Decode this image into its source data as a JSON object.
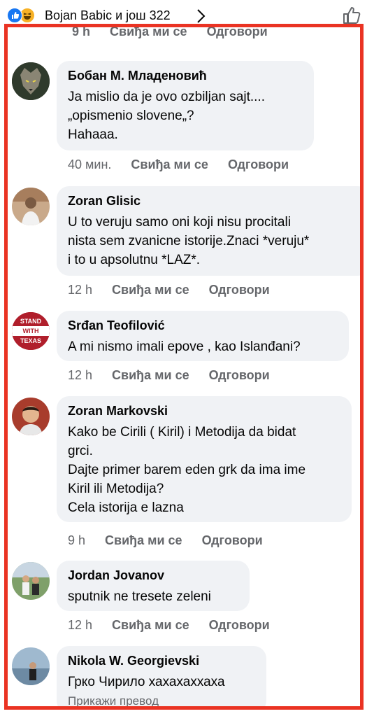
{
  "header": {
    "reactors_text": "Bojan Babic и још 322",
    "icons": [
      "like-reaction-icon",
      "haha-reaction-icon",
      "chevron-right-icon",
      "thumbs-up-icon"
    ]
  },
  "top_cut_actions": {
    "time": "9 h",
    "like": "Свиђа ми се",
    "reply": "Одговори"
  },
  "comments": [
    {
      "author": "Бобан М. Младеновић",
      "text": "Ja mislio da je ovo ozbiljan sajt....\n„opismenio slovene„?\nHahaaa.",
      "time": "40 мин.",
      "like": "Свиђа ми се",
      "reply": "Одговори"
    },
    {
      "author": "Zoran Glisic",
      "text": "U to veruju samo oni koji nisu procitali\nnista sem zvanicne istorije.Znaci *veruju*\ni to u apsolutnu *LAZ*.",
      "time": "12 h",
      "like": "Свиђа ми се",
      "reply": "Одговори"
    },
    {
      "author": "Srđan Teofilović",
      "avatar_text": "STAND WITH TEXAS",
      "text": "A mi nismo imali epove , kao Islanđani?",
      "time": "12 h",
      "like": "Свиђа ми се",
      "reply": "Одговори"
    },
    {
      "author": "Zoran Markovski",
      "text": "Kako be Cirili ( Kiril) i Metodija da bidat\ngrci.\nDajte primer barem eden grk da ima ime\nKiril ili Metodija?\nCela istorija e lazna",
      "time": "9 h",
      "like": "Свиђа ми се",
      "reply": "Одговори"
    },
    {
      "author": "Jordan Jovanov",
      "text": "sputnik ne tresete zeleni",
      "time": "12 h",
      "like": "Свиђа ми се",
      "reply": "Одговори"
    },
    {
      "author": "Nikola W. Georgievski",
      "text": "Грко Чирило хахахаххаха",
      "translate": "Прикажи превод"
    }
  ],
  "colors": {
    "frame": "#ea3323",
    "bubble": "#f0f2f5",
    "meta": "#65676b",
    "like_blue": "#1877f2"
  }
}
